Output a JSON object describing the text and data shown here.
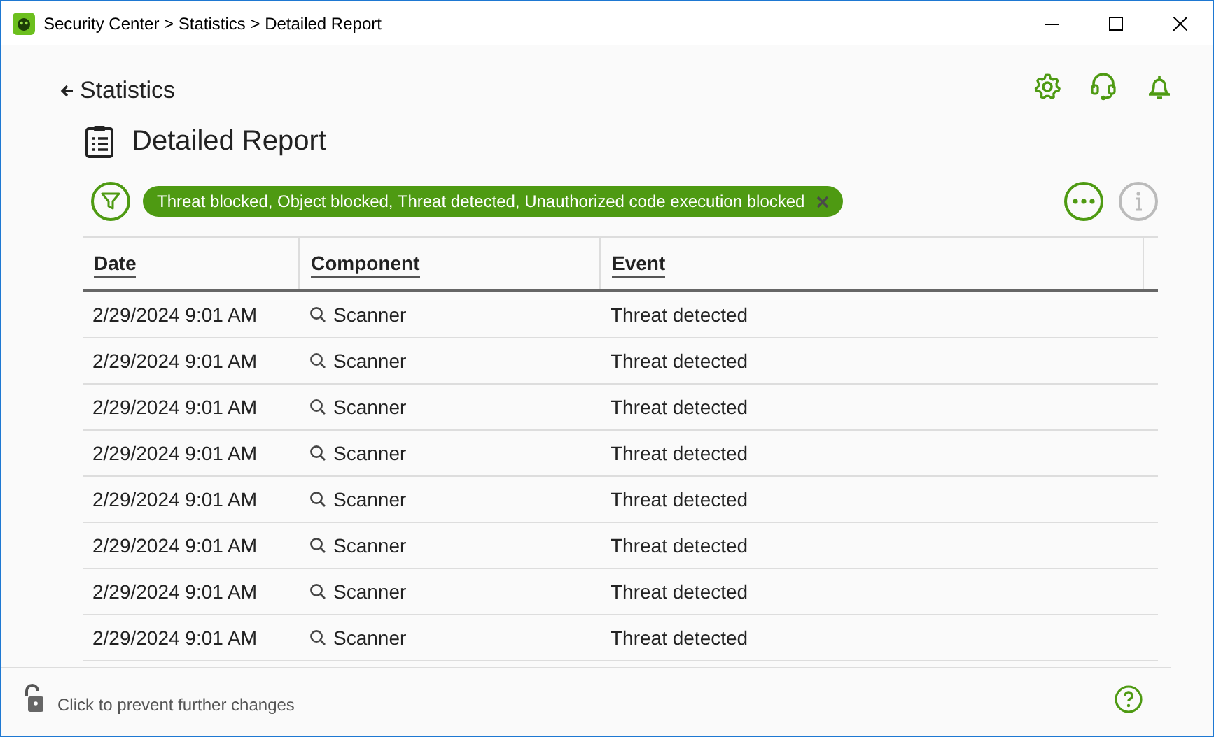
{
  "window": {
    "title": "Security Center > Statistics > Detailed Report"
  },
  "back_link": "Statistics",
  "page_title": "Detailed Report",
  "filter": {
    "chip": "Threat blocked, Object blocked, Threat detected, Unauthorized code execution blocked"
  },
  "table": {
    "columns": [
      "Date",
      "Component",
      "Event"
    ],
    "rows": [
      {
        "date": "2/29/2024 9:01 AM",
        "component": "Scanner",
        "event": "Threat detected"
      },
      {
        "date": "2/29/2024 9:01 AM",
        "component": "Scanner",
        "event": "Threat detected"
      },
      {
        "date": "2/29/2024 9:01 AM",
        "component": "Scanner",
        "event": "Threat detected"
      },
      {
        "date": "2/29/2024 9:01 AM",
        "component": "Scanner",
        "event": "Threat detected"
      },
      {
        "date": "2/29/2024 9:01 AM",
        "component": "Scanner",
        "event": "Threat detected"
      },
      {
        "date": "2/29/2024 9:01 AM",
        "component": "Scanner",
        "event": "Threat detected"
      },
      {
        "date": "2/29/2024 9:01 AM",
        "component": "Scanner",
        "event": "Threat detected"
      },
      {
        "date": "2/29/2024 9:01 AM",
        "component": "Scanner",
        "event": "Threat detected"
      }
    ]
  },
  "status_bar": {
    "locked": false,
    "text": "Click to prevent further changes"
  }
}
